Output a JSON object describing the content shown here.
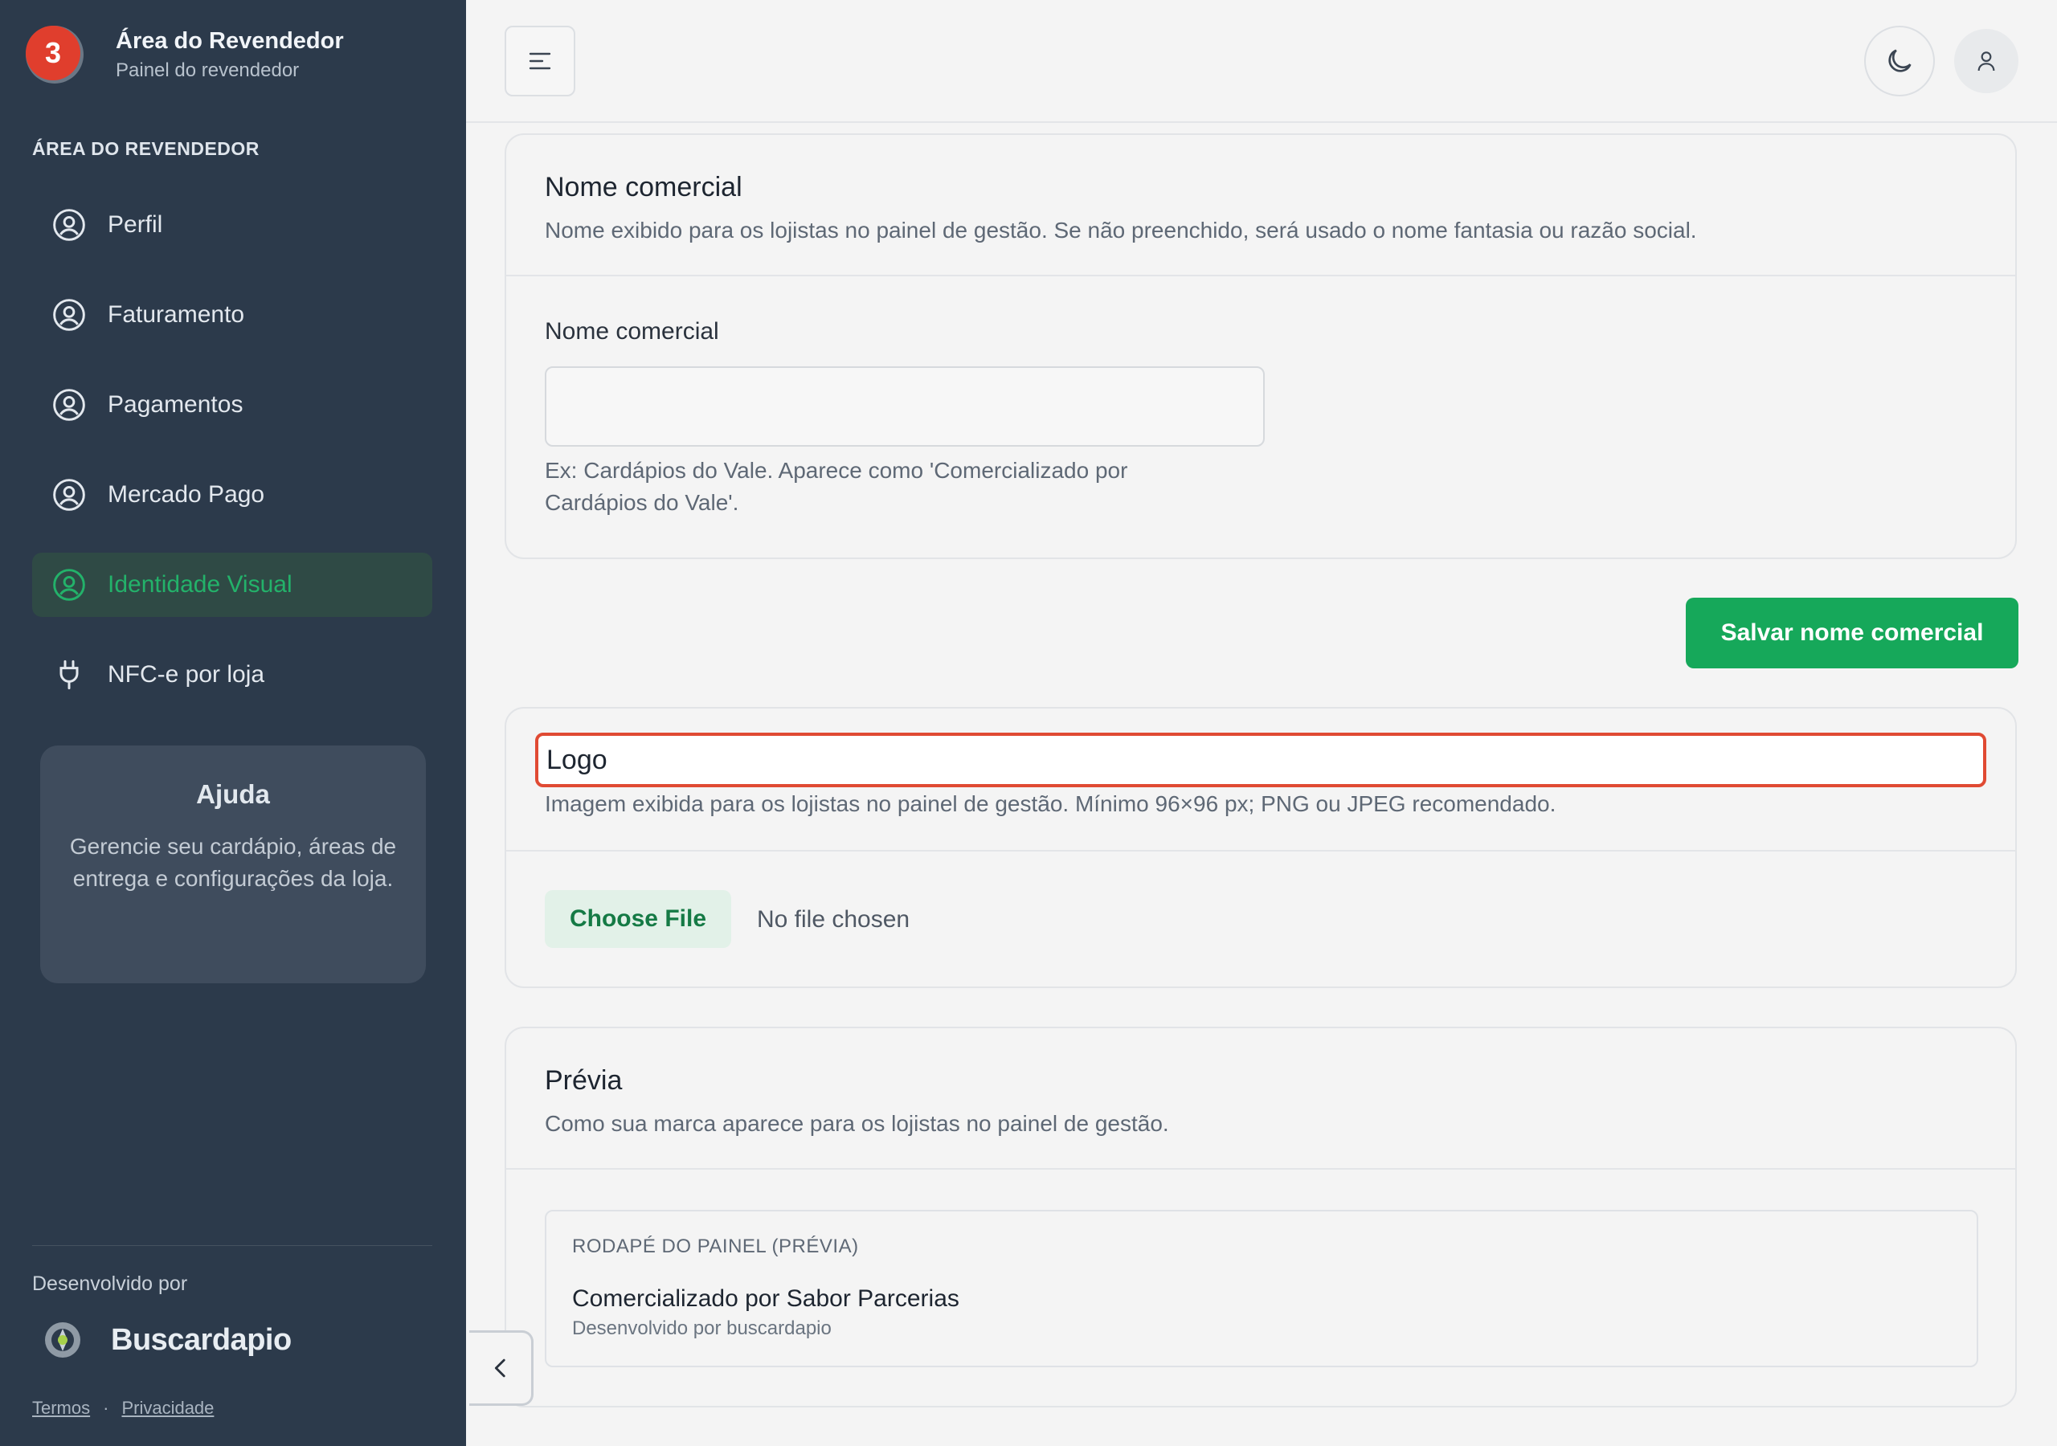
{
  "sidebar": {
    "badge_count": "3",
    "brand_title": "Área do Revendedor",
    "brand_subtitle": "Painel do revendedor",
    "section_label": "ÁREA DO REVENDEDOR",
    "items": [
      {
        "label": "Perfil",
        "icon": "user-circle-icon"
      },
      {
        "label": "Faturamento",
        "icon": "user-circle-icon"
      },
      {
        "label": "Pagamentos",
        "icon": "user-circle-icon"
      },
      {
        "label": "Mercado Pago",
        "icon": "user-circle-icon"
      },
      {
        "label": "Identidade Visual",
        "icon": "user-circle-icon",
        "active": true
      },
      {
        "label": "NFC-e por loja",
        "icon": "plug-icon"
      }
    ],
    "help": {
      "title": "Ajuda",
      "text": "Gerencie seu cardápio, áreas de entrega e configurações da loja."
    },
    "developed_by": "Desenvolvido por",
    "dev_brand": "Buscardapio",
    "legal": {
      "terms": "Termos",
      "separator": "·",
      "privacy": "Privacidade"
    }
  },
  "header": {
    "menu_icon": "hamburger-icon",
    "theme_icon": "moon-icon",
    "user_icon": "user-icon"
  },
  "commercial_name": {
    "title": "Nome comercial",
    "description": "Nome exibido para os lojistas no painel de gestão. Se não preenchido, será usado o nome fantasia ou razão social.",
    "field_label": "Nome comercial",
    "value": "",
    "hint": "Ex: Cardápios do Vale. Aparece como 'Comercializado por Cardápios do Vale'.",
    "save_label": "Salvar nome comercial"
  },
  "logo": {
    "title": "Logo",
    "description": "Imagem exibida para os lojistas no painel de gestão. Mínimo 96×96 px; PNG ou JPEG recomendado.",
    "choose_file": "Choose File",
    "file_status": "No file chosen"
  },
  "preview": {
    "title": "Prévia",
    "description": "Como sua marca aparece para os lojistas no painel de gestão.",
    "box_label": "RODAPÉ DO PAINEL (PRÉVIA)",
    "main_text": "Comercializado por Sabor Parcerias",
    "sub_text": "Desenvolvido por buscardapio"
  },
  "colors": {
    "sidebar_bg": "#2c3a4b",
    "accent_green": "#16a85a",
    "badge_red": "#e03e2d",
    "highlight_red": "#e04a33"
  }
}
